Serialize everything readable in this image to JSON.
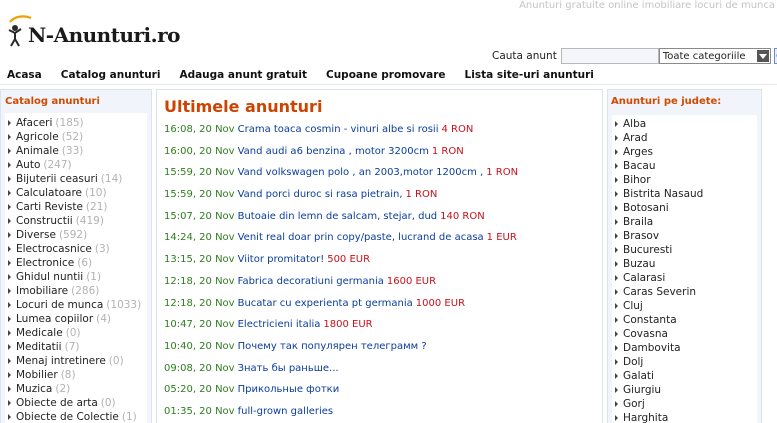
{
  "header": {
    "tagline": "Anunturi gratuite online imobiliare locuri de munca",
    "logo_text": "N-Anunturi.ro"
  },
  "search": {
    "label": "Cauta anunt",
    "input_value": "",
    "category_selected": "Toate categoriile"
  },
  "nav": {
    "items": [
      "Acasa",
      "Catalog anunturi",
      "Adauga anunt gratuit",
      "Cupoane promovare",
      "Lista site-uri anunturi"
    ]
  },
  "catalog": {
    "title": "Catalog anunturi",
    "items": [
      {
        "name": "Afaceri",
        "count": "(185)"
      },
      {
        "name": "Agricole",
        "count": "(52)"
      },
      {
        "name": "Animale",
        "count": "(33)"
      },
      {
        "name": "Auto",
        "count": "(247)"
      },
      {
        "name": "Bijuterii ceasuri",
        "count": "(14)"
      },
      {
        "name": "Calculatoare",
        "count": "(10)"
      },
      {
        "name": "Carti Reviste",
        "count": "(21)"
      },
      {
        "name": "Constructii",
        "count": "(419)"
      },
      {
        "name": "Diverse",
        "count": "(592)"
      },
      {
        "name": "Electrocasnice",
        "count": "(3)"
      },
      {
        "name": "Electronice",
        "count": "(6)"
      },
      {
        "name": "Ghidul nuntii",
        "count": "(1)"
      },
      {
        "name": "Imobiliare",
        "count": "(286)"
      },
      {
        "name": "Locuri de munca",
        "count": "(1033)"
      },
      {
        "name": "Lumea copiilor",
        "count": "(4)"
      },
      {
        "name": "Medicale",
        "count": "(0)"
      },
      {
        "name": "Meditatii",
        "count": "(7)"
      },
      {
        "name": "Menaj intretinere",
        "count": "(0)"
      },
      {
        "name": "Mobilier",
        "count": "(8)"
      },
      {
        "name": "Muzica",
        "count": "(2)"
      },
      {
        "name": "Obiecte de arta",
        "count": "(0)"
      },
      {
        "name": "Obiecte de Colectie",
        "count": "(1)"
      }
    ]
  },
  "latest": {
    "title": "Ultimele anunturi",
    "ads": [
      {
        "date": "16:08, 20 Nov",
        "title": "Crama toaca cosmin - vinuri albe si rosii",
        "price": "4 RON"
      },
      {
        "date": "16:00, 20 Nov",
        "title": "Vand audi a6 benzina , motor 3200cm",
        "price": "1 RON"
      },
      {
        "date": "15:59, 20 Nov",
        "title": "Vand volkswagen polo , an 2003,motor 1200cm ,",
        "price": "1 RON"
      },
      {
        "date": "15:59, 20 Nov",
        "title": "Vand porci duroc si rasa pietrain,",
        "price": "1 RON"
      },
      {
        "date": "15:07, 20 Nov",
        "title": "Butoaie din lemn de salcam, stejar, dud",
        "price": "140 RON"
      },
      {
        "date": "14:24, 20 Nov",
        "title": "Venit real doar prin copy/paste, lucrand de acasa",
        "price": "1 EUR"
      },
      {
        "date": "13:15, 20 Nov",
        "title": "Viitor promitator!",
        "price": "500 EUR"
      },
      {
        "date": "12:18, 20 Nov",
        "title": "Fabrica decoratiuni germania",
        "price": "1600 EUR"
      },
      {
        "date": "12:18, 20 Nov",
        "title": "Bucatar cu experienta pt germania",
        "price": "1000 EUR"
      },
      {
        "date": "10:47, 20 Nov",
        "title": "Electricieni italia",
        "price": "1800 EUR"
      },
      {
        "date": "10:40, 20 Nov",
        "title": "Почему так популярен телеграмм ?",
        "price": ""
      },
      {
        "date": "09:08, 20 Nov",
        "title": "Знать бы раньше...",
        "price": ""
      },
      {
        "date": "05:20, 20 Nov",
        "title": "Прикольные фотки",
        "price": ""
      },
      {
        "date": "01:35, 20 Nov",
        "title": "full-grown galleries",
        "price": ""
      }
    ]
  },
  "counties": {
    "title": "Anunturi pe judete:",
    "items": [
      "Alba",
      "Arad",
      "Arges",
      "Bacau",
      "Bihor",
      "Bistrita Nasaud",
      "Botosani",
      "Braila",
      "Brasov",
      "Bucuresti",
      "Buzau",
      "Calarasi",
      "Caras Severin",
      "Cluj",
      "Constanta",
      "Covasna",
      "Dambovita",
      "Dolj",
      "Galati",
      "Giurgiu",
      "Gorj",
      "Harghita"
    ]
  }
}
